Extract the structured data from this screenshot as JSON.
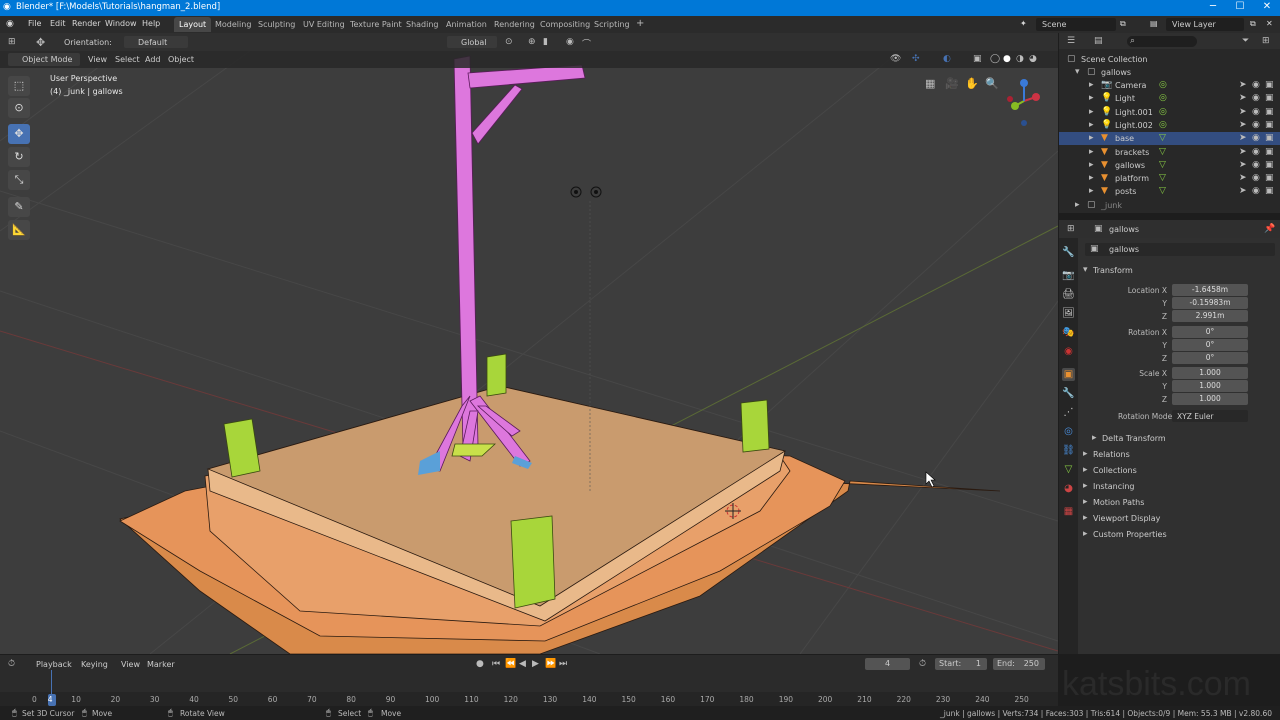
{
  "window": {
    "title": "Blender* [F:\\Models\\Tutorials\\hangman_2.blend]",
    "controls": [
      "─",
      "☐",
      "✕"
    ]
  },
  "menu": {
    "items": [
      "File",
      "Edit",
      "Render",
      "Window",
      "Help"
    ]
  },
  "workspaces": [
    "Layout",
    "Modeling",
    "Sculpting",
    "UV Editing",
    "Texture Paint",
    "Shading",
    "Animation",
    "Rendering",
    "Compositing",
    "Scripting"
  ],
  "workspace_add": "+",
  "scene": {
    "label": "Scene",
    "view_layer": "View Layer"
  },
  "toolheader": {
    "orientation_label": "Orientation:",
    "orientation_value": "Default",
    "transform_orientation": "Global"
  },
  "viewport_header": {
    "mode": "Object Mode",
    "menus": [
      "View",
      "Select",
      "Add",
      "Object"
    ]
  },
  "viewport": {
    "perspective": "User Perspective",
    "collection_info": "(4) _junk | gallows"
  },
  "tools": [
    "select-box",
    "cursor",
    "move",
    "rotate",
    "scale",
    "annotate",
    "measure"
  ],
  "outliner": {
    "root": "Scene Collection",
    "collection": "gallows",
    "items": [
      {
        "name": "Camera",
        "kind": "camera"
      },
      {
        "name": "Light",
        "kind": "light"
      },
      {
        "name": "Light.001",
        "kind": "light"
      },
      {
        "name": "Light.002",
        "kind": "light"
      },
      {
        "name": "base",
        "kind": "mesh",
        "selected": true
      },
      {
        "name": "brackets",
        "kind": "mesh"
      },
      {
        "name": "gallows",
        "kind": "mesh"
      },
      {
        "name": "platform",
        "kind": "mesh"
      },
      {
        "name": "posts",
        "kind": "mesh"
      }
    ],
    "junk": "_junk"
  },
  "properties": {
    "object_name": "gallows",
    "data_name": "gallows",
    "transform_label": "Transform",
    "location": {
      "label": "Location X",
      "x": "-1.6458m",
      "y": "-0.15983m",
      "z": "2.991m"
    },
    "rotation": {
      "label": "Rotation X",
      "x": "0°",
      "y": "0°",
      "z": "0°"
    },
    "scale": {
      "label": "Scale X",
      "x": "1.000",
      "y": "1.000",
      "z": "1.000"
    },
    "axis_y": "Y",
    "axis_z": "Z",
    "rotation_mode_label": "Rotation Mode",
    "rotation_mode": "XYZ Euler",
    "sections": [
      "Delta Transform",
      "Relations",
      "Collections",
      "Instancing",
      "Motion Paths",
      "Viewport Display",
      "Custom Properties"
    ]
  },
  "timeline": {
    "menus": [
      "Playback",
      "Keying",
      "View",
      "Marker"
    ],
    "current_frame": "4",
    "start_label": "Start:",
    "start": "1",
    "end_label": "End:",
    "end": "250",
    "ticks": [
      "0",
      "4",
      "10",
      "20",
      "30",
      "40",
      "50",
      "60",
      "70",
      "80",
      "90",
      "100",
      "110",
      "120",
      "130",
      "140",
      "150",
      "160",
      "170",
      "180",
      "190",
      "200",
      "210",
      "220",
      "230",
      "240",
      "250"
    ]
  },
  "status": {
    "left": [
      "Set 3D Cursor",
      "Move",
      "Rotate View"
    ],
    "mid": [
      "Select",
      "Move"
    ],
    "right": "_junk | gallows | Verts:734 | Faces:303 | Tris:614 | Objects:0/9 | Mem: 55.3 MB | v2.80.60"
  },
  "watermark": "katsbits.com",
  "colors": {
    "accent": "#4772b3",
    "titlebar": "#0078d7",
    "selection": "#334d80",
    "gallows": "#dd77dd",
    "posts": "#a8d63a",
    "platform": "#d7a472"
  }
}
